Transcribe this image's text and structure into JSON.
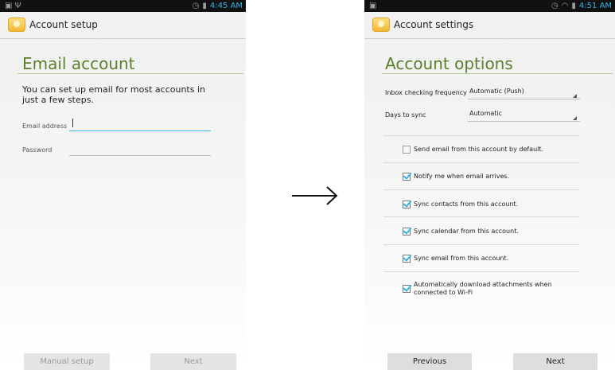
{
  "left": {
    "status_time": "4:45 AM",
    "action_title": "Account setup",
    "section_title": "Email account",
    "intro": "You can set up email for most accounts in just a few steps.",
    "email_label": "Email address",
    "email_value": "",
    "password_label": "Password",
    "password_value": "",
    "manual_setup_label": "Manual setup",
    "next_label": "Next"
  },
  "right": {
    "status_time": "4:51 AM",
    "action_title": "Account settings",
    "section_title": "Account options",
    "inbox_freq_label": "Inbox checking frequency",
    "inbox_freq_value": "Automatic (Push)",
    "days_sync_label": "Days to sync",
    "days_sync_value": "Automatic",
    "options": [
      {
        "label": "Send email from this account by default.",
        "checked": false
      },
      {
        "label": "Notify me when email arrives.",
        "checked": true
      },
      {
        "label": "Sync contacts from this account.",
        "checked": true
      },
      {
        "label": "Sync calendar from this account.",
        "checked": true
      },
      {
        "label": "Sync email from this account.",
        "checked": true
      },
      {
        "label": "Automatically download attachments when connected to Wi-Fi",
        "checked": true
      }
    ],
    "previous_label": "Previous",
    "next_label": "Next"
  },
  "transition_arrow": "→",
  "colors": {
    "accent": "#33b5e5",
    "title_green": "#5b7f2a"
  },
  "icons": [
    "image-icon",
    "usb-icon",
    "alarm-icon",
    "wifi-icon",
    "battery-icon",
    "email-app-icon",
    "checkbox-icon",
    "spinner-arrow-icon",
    "right-arrow-icon"
  ]
}
